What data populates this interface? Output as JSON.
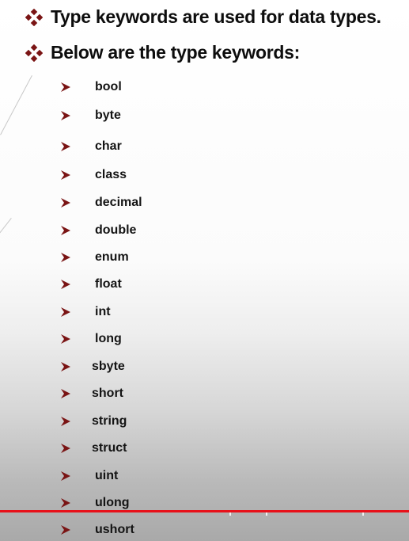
{
  "headings": [
    "Type keywords are used for data types.",
    "Below are the type keywords:"
  ],
  "keywords": [
    "bool",
    "byte",
    "char",
    "class",
    "decimal",
    "double",
    "enum",
    "float",
    "int",
    "long",
    "sbyte",
    "short",
    "string",
    "struct",
    "uint",
    "ulong",
    "ushort"
  ],
  "colors": {
    "bullet": "#7a1414",
    "arrow": "#7a1414",
    "rule": "#e8111a"
  },
  "icons": {
    "heading_bullet": "diamond-bullet-icon",
    "list_bullet": "arrowhead-bullet-icon"
  }
}
